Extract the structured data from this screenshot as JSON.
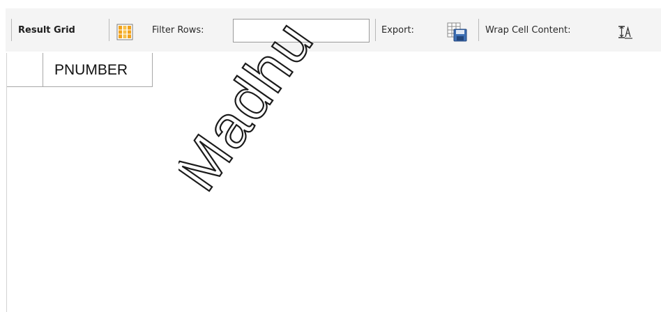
{
  "toolbar": {
    "result_grid_label": "Result Grid",
    "filter_rows_label": "Filter Rows:",
    "filter_rows_value": "",
    "export_label": "Export:",
    "wrap_cell_content_label": "Wrap Cell Content:"
  },
  "grid": {
    "columns": [
      "PNUMBER"
    ],
    "rows": []
  },
  "watermark": {
    "text": "Madhu",
    "color": "#1a1a1a"
  },
  "colors": {
    "toolbar_bg": "#f4f4f4",
    "grid_border": "#a8a8a8",
    "grid_icon_orange": "#f2a21a",
    "export_icon_blue": "#3d6fb4"
  },
  "icons": {
    "form_editor": "columns-grid-icon",
    "export": "export-save-icon",
    "wrap": "wrap-text-icon"
  }
}
